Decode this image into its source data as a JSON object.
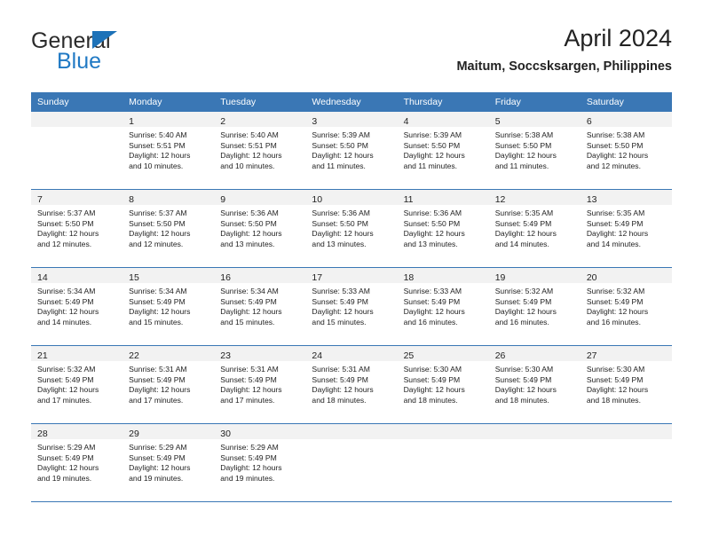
{
  "brand": {
    "name_part1": "General",
    "name_part2": "Blue",
    "triangle_color": "#1d72b8",
    "blue_color": "#2079c4"
  },
  "header": {
    "title": "April 2024",
    "subtitle": "Maitum, Soccsksargen, Philippines"
  },
  "theme": {
    "header_row_bg": "#3a77b5",
    "daynum_band_bg": "#f2f2f2",
    "week_divider": "#3a77b5",
    "text": "#222222"
  },
  "columns": [
    "Sunday",
    "Monday",
    "Tuesday",
    "Wednesday",
    "Thursday",
    "Friday",
    "Saturday"
  ],
  "labels": {
    "sunrise_prefix": "Sunrise: ",
    "sunset_prefix": "Sunset: ",
    "daylight_prefix": "Daylight: "
  },
  "weeks": [
    [
      {
        "day": "",
        "sunrise": "",
        "sunset": "",
        "daylight_line1": "",
        "daylight_line2": ""
      },
      {
        "day": "1",
        "sunrise": "Sunrise: 5:40 AM",
        "sunset": "Sunset: 5:51 PM",
        "daylight_line1": "Daylight: 12 hours",
        "daylight_line2": "and 10 minutes."
      },
      {
        "day": "2",
        "sunrise": "Sunrise: 5:40 AM",
        "sunset": "Sunset: 5:51 PM",
        "daylight_line1": "Daylight: 12 hours",
        "daylight_line2": "and 10 minutes."
      },
      {
        "day": "3",
        "sunrise": "Sunrise: 5:39 AM",
        "sunset": "Sunset: 5:50 PM",
        "daylight_line1": "Daylight: 12 hours",
        "daylight_line2": "and 11 minutes."
      },
      {
        "day": "4",
        "sunrise": "Sunrise: 5:39 AM",
        "sunset": "Sunset: 5:50 PM",
        "daylight_line1": "Daylight: 12 hours",
        "daylight_line2": "and 11 minutes."
      },
      {
        "day": "5",
        "sunrise": "Sunrise: 5:38 AM",
        "sunset": "Sunset: 5:50 PM",
        "daylight_line1": "Daylight: 12 hours",
        "daylight_line2": "and 11 minutes."
      },
      {
        "day": "6",
        "sunrise": "Sunrise: 5:38 AM",
        "sunset": "Sunset: 5:50 PM",
        "daylight_line1": "Daylight: 12 hours",
        "daylight_line2": "and 12 minutes."
      }
    ],
    [
      {
        "day": "7",
        "sunrise": "Sunrise: 5:37 AM",
        "sunset": "Sunset: 5:50 PM",
        "daylight_line1": "Daylight: 12 hours",
        "daylight_line2": "and 12 minutes."
      },
      {
        "day": "8",
        "sunrise": "Sunrise: 5:37 AM",
        "sunset": "Sunset: 5:50 PM",
        "daylight_line1": "Daylight: 12 hours",
        "daylight_line2": "and 12 minutes."
      },
      {
        "day": "9",
        "sunrise": "Sunrise: 5:36 AM",
        "sunset": "Sunset: 5:50 PM",
        "daylight_line1": "Daylight: 12 hours",
        "daylight_line2": "and 13 minutes."
      },
      {
        "day": "10",
        "sunrise": "Sunrise: 5:36 AM",
        "sunset": "Sunset: 5:50 PM",
        "daylight_line1": "Daylight: 12 hours",
        "daylight_line2": "and 13 minutes."
      },
      {
        "day": "11",
        "sunrise": "Sunrise: 5:36 AM",
        "sunset": "Sunset: 5:50 PM",
        "daylight_line1": "Daylight: 12 hours",
        "daylight_line2": "and 13 minutes."
      },
      {
        "day": "12",
        "sunrise": "Sunrise: 5:35 AM",
        "sunset": "Sunset: 5:49 PM",
        "daylight_line1": "Daylight: 12 hours",
        "daylight_line2": "and 14 minutes."
      },
      {
        "day": "13",
        "sunrise": "Sunrise: 5:35 AM",
        "sunset": "Sunset: 5:49 PM",
        "daylight_line1": "Daylight: 12 hours",
        "daylight_line2": "and 14 minutes."
      }
    ],
    [
      {
        "day": "14",
        "sunrise": "Sunrise: 5:34 AM",
        "sunset": "Sunset: 5:49 PM",
        "daylight_line1": "Daylight: 12 hours",
        "daylight_line2": "and 14 minutes."
      },
      {
        "day": "15",
        "sunrise": "Sunrise: 5:34 AM",
        "sunset": "Sunset: 5:49 PM",
        "daylight_line1": "Daylight: 12 hours",
        "daylight_line2": "and 15 minutes."
      },
      {
        "day": "16",
        "sunrise": "Sunrise: 5:34 AM",
        "sunset": "Sunset: 5:49 PM",
        "daylight_line1": "Daylight: 12 hours",
        "daylight_line2": "and 15 minutes."
      },
      {
        "day": "17",
        "sunrise": "Sunrise: 5:33 AM",
        "sunset": "Sunset: 5:49 PM",
        "daylight_line1": "Daylight: 12 hours",
        "daylight_line2": "and 15 minutes."
      },
      {
        "day": "18",
        "sunrise": "Sunrise: 5:33 AM",
        "sunset": "Sunset: 5:49 PM",
        "daylight_line1": "Daylight: 12 hours",
        "daylight_line2": "and 16 minutes."
      },
      {
        "day": "19",
        "sunrise": "Sunrise: 5:32 AM",
        "sunset": "Sunset: 5:49 PM",
        "daylight_line1": "Daylight: 12 hours",
        "daylight_line2": "and 16 minutes."
      },
      {
        "day": "20",
        "sunrise": "Sunrise: 5:32 AM",
        "sunset": "Sunset: 5:49 PM",
        "daylight_line1": "Daylight: 12 hours",
        "daylight_line2": "and 16 minutes."
      }
    ],
    [
      {
        "day": "21",
        "sunrise": "Sunrise: 5:32 AM",
        "sunset": "Sunset: 5:49 PM",
        "daylight_line1": "Daylight: 12 hours",
        "daylight_line2": "and 17 minutes."
      },
      {
        "day": "22",
        "sunrise": "Sunrise: 5:31 AM",
        "sunset": "Sunset: 5:49 PM",
        "daylight_line1": "Daylight: 12 hours",
        "daylight_line2": "and 17 minutes."
      },
      {
        "day": "23",
        "sunrise": "Sunrise: 5:31 AM",
        "sunset": "Sunset: 5:49 PM",
        "daylight_line1": "Daylight: 12 hours",
        "daylight_line2": "and 17 minutes."
      },
      {
        "day": "24",
        "sunrise": "Sunrise: 5:31 AM",
        "sunset": "Sunset: 5:49 PM",
        "daylight_line1": "Daylight: 12 hours",
        "daylight_line2": "and 18 minutes."
      },
      {
        "day": "25",
        "sunrise": "Sunrise: 5:30 AM",
        "sunset": "Sunset: 5:49 PM",
        "daylight_line1": "Daylight: 12 hours",
        "daylight_line2": "and 18 minutes."
      },
      {
        "day": "26",
        "sunrise": "Sunrise: 5:30 AM",
        "sunset": "Sunset: 5:49 PM",
        "daylight_line1": "Daylight: 12 hours",
        "daylight_line2": "and 18 minutes."
      },
      {
        "day": "27",
        "sunrise": "Sunrise: 5:30 AM",
        "sunset": "Sunset: 5:49 PM",
        "daylight_line1": "Daylight: 12 hours",
        "daylight_line2": "and 18 minutes."
      }
    ],
    [
      {
        "day": "28",
        "sunrise": "Sunrise: 5:29 AM",
        "sunset": "Sunset: 5:49 PM",
        "daylight_line1": "Daylight: 12 hours",
        "daylight_line2": "and 19 minutes."
      },
      {
        "day": "29",
        "sunrise": "Sunrise: 5:29 AM",
        "sunset": "Sunset: 5:49 PM",
        "daylight_line1": "Daylight: 12 hours",
        "daylight_line2": "and 19 minutes."
      },
      {
        "day": "30",
        "sunrise": "Sunrise: 5:29 AM",
        "sunset": "Sunset: 5:49 PM",
        "daylight_line1": "Daylight: 12 hours",
        "daylight_line2": "and 19 minutes."
      },
      {
        "day": "",
        "sunrise": "",
        "sunset": "",
        "daylight_line1": "",
        "daylight_line2": ""
      },
      {
        "day": "",
        "sunrise": "",
        "sunset": "",
        "daylight_line1": "",
        "daylight_line2": ""
      },
      {
        "day": "",
        "sunrise": "",
        "sunset": "",
        "daylight_line1": "",
        "daylight_line2": ""
      },
      {
        "day": "",
        "sunrise": "",
        "sunset": "",
        "daylight_line1": "",
        "daylight_line2": ""
      }
    ]
  ]
}
